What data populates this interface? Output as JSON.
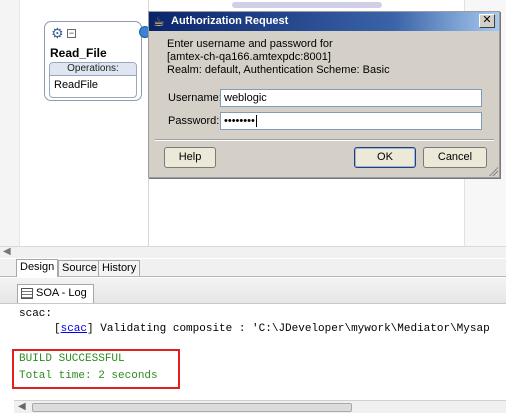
{
  "component": {
    "title": "Read_File",
    "operations_header": "Operations:",
    "operation": "ReadFile",
    "gear_glyph": "⚙",
    "collapse_glyph": "−"
  },
  "dialog": {
    "title": "Authorization Request",
    "close_glyph": "✕",
    "message_line1": "Enter username and password for",
    "message_line2": "[amtex-ch-qa166.amtexpdc:8001]",
    "message_line3": "Realm: default, Authentication Scheme: Basic",
    "username_label": "Username:",
    "username_value": "weblogic",
    "password_label": "Password:",
    "password_value": "••••••••",
    "help_label": "Help",
    "ok_label": "OK",
    "cancel_label": "Cancel"
  },
  "tabs": [
    {
      "label": "Design"
    },
    {
      "label": "Source"
    },
    {
      "label": "History"
    }
  ],
  "log": {
    "tab_label": "SOA - Log",
    "line1": "scac:",
    "line2_link": "scac",
    "line2_text": " Validating composite : 'C:\\JDeveloper\\mywork\\Mediator\\Mysap",
    "build_status": "BUILD SUCCESSFUL",
    "total_time": "Total time: 2 seconds"
  },
  "icons": {
    "scroll_left": "◀",
    "title_icon": "☕"
  },
  "colors": {
    "titlebar": "#0a246a",
    "success_text": "#2e8b20",
    "highlight_border": "#e02020",
    "link": "#0000ee"
  }
}
